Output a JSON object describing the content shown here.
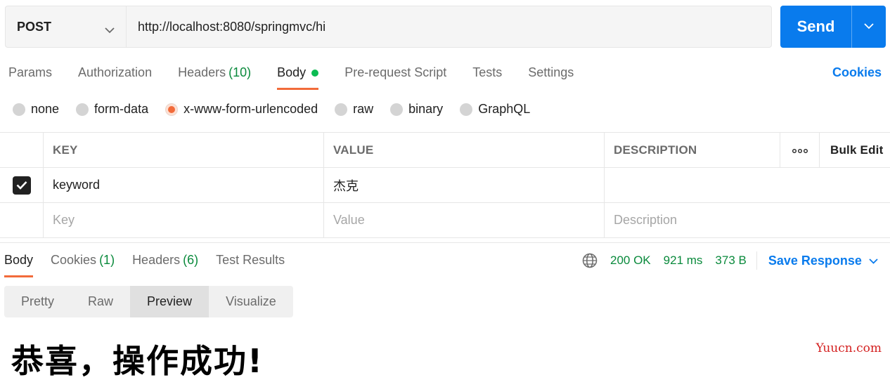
{
  "request": {
    "method": "POST",
    "url": "http://localhost:8080/springmvc/hi",
    "send_label": "Send"
  },
  "request_tabs": [
    {
      "label": "Params",
      "count": ""
    },
    {
      "label": "Authorization",
      "count": ""
    },
    {
      "label": "Headers",
      "count": "(10)"
    },
    {
      "label": "Body",
      "count": ""
    },
    {
      "label": "Pre-request Script",
      "count": ""
    },
    {
      "label": "Tests",
      "count": ""
    },
    {
      "label": "Settings",
      "count": ""
    }
  ],
  "active_request_tab": "Body",
  "cookies_link": "Cookies",
  "body_types": [
    "none",
    "form-data",
    "x-www-form-urlencoded",
    "raw",
    "binary",
    "GraphQL"
  ],
  "selected_body_type": "x-www-form-urlencoded",
  "params_table": {
    "headers": {
      "key": "KEY",
      "value": "VALUE",
      "description": "DESCRIPTION",
      "bulk_edit": "Bulk Edit"
    },
    "rows": [
      {
        "checked": true,
        "key": "keyword",
        "value": "杰克",
        "description": ""
      }
    ],
    "placeholders": {
      "key": "Key",
      "value": "Value",
      "description": "Description"
    }
  },
  "response_tabs": [
    {
      "label": "Body",
      "count": ""
    },
    {
      "label": "Cookies",
      "count": "(1)"
    },
    {
      "label": "Headers",
      "count": "(6)"
    },
    {
      "label": "Test Results",
      "count": ""
    }
  ],
  "active_response_tab": "Body",
  "response_meta": {
    "status": "200 OK",
    "time": "921 ms",
    "size": "373 B",
    "save_label": "Save Response"
  },
  "formats": [
    "Pretty",
    "Raw",
    "Preview",
    "Visualize"
  ],
  "active_format": "Preview",
  "preview": {
    "heading": "恭喜，操作成功!"
  },
  "watermark": "Yuucn.com",
  "colors": {
    "accent_blue": "#097bed",
    "accent_orange": "#f26b3a",
    "success_green": "#0a8a3c",
    "dot_green": "#0cbb52",
    "watermark_red": "#d42020"
  }
}
